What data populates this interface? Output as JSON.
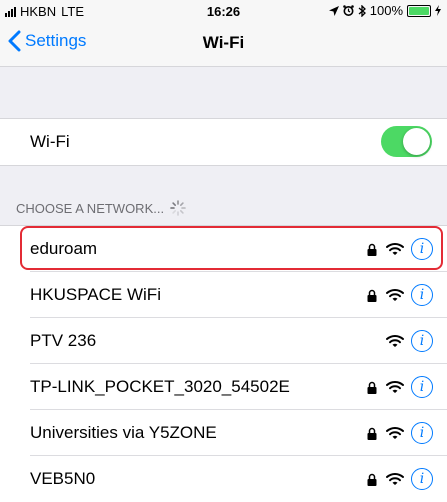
{
  "status_bar": {
    "carrier": "HKBN",
    "network": "LTE",
    "time": "16:26",
    "battery": "100%"
  },
  "nav": {
    "back_label": "Settings",
    "title": "Wi-Fi"
  },
  "wifi_toggle": {
    "label": "Wi-Fi",
    "on": true
  },
  "section_header": "CHOOSE A NETWORK...",
  "networks": [
    {
      "name": "eduroam",
      "secured": true
    },
    {
      "name": "HKUSPACE WiFi",
      "secured": true
    },
    {
      "name": "PTV 236",
      "secured": false
    },
    {
      "name": "TP-LINK_POCKET_3020_54502E",
      "secured": true
    },
    {
      "name": "Universities via Y5ZONE",
      "secured": true
    },
    {
      "name": "VEB5N0",
      "secured": true
    }
  ],
  "colors": {
    "accent": "#007aff",
    "toggle_on": "#4cd964",
    "highlight": "#e32b35"
  }
}
